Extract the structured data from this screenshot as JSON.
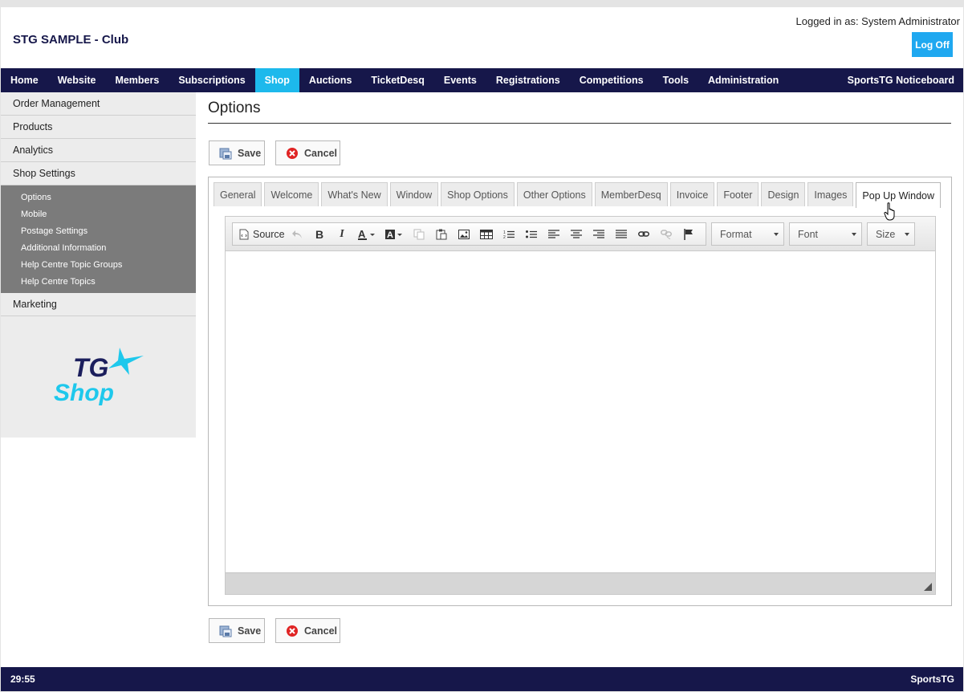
{
  "header": {
    "site_title": "STG SAMPLE - Club",
    "logged_in_text": "Logged in as: System Administrator",
    "logoff_label": "Log Off"
  },
  "nav": {
    "items": [
      "Home",
      "Website",
      "Members",
      "Subscriptions",
      "Shop",
      "Auctions",
      "TicketDesq",
      "Events",
      "Registrations",
      "Competitions",
      "Tools",
      "Administration"
    ],
    "active": "Shop",
    "right_label": "SportsTG Noticeboard"
  },
  "sidebar": {
    "items": [
      "Order Management",
      "Products",
      "Analytics",
      "Shop Settings"
    ],
    "sub_items": [
      "Options",
      "Mobile",
      "Postage Settings",
      "Additional Information",
      "Help Centre Topic Groups",
      "Help Centre Topics"
    ],
    "after_items": [
      "Marketing"
    ],
    "logo_text_top": "TG",
    "logo_text_bottom": "Shop"
  },
  "main": {
    "title": "Options",
    "save_label": "Save",
    "cancel_label": "Cancel",
    "tabs": [
      "General",
      "Welcome",
      "What's New",
      "Window",
      "Shop Options",
      "Other Options",
      "MemberDesq",
      "Invoice",
      "Footer",
      "Design",
      "Images",
      "Pop Up Window"
    ],
    "active_tab": "Pop Up Window"
  },
  "editor": {
    "source_label": "Source",
    "format_label": "Format",
    "font_label": "Font",
    "size_label": "Size",
    "toolbar_icons": [
      "undo-icon",
      "bold-icon",
      "italic-icon",
      "text-color-icon",
      "background-color-icon",
      "copy-icon",
      "paste-icon",
      "image-icon",
      "table-icon",
      "numbered-list-icon",
      "bulleted-list-icon",
      "align-left-icon",
      "align-center-icon",
      "align-right-icon",
      "justify-icon",
      "link-icon",
      "unlink-icon",
      "anchor-flag-icon"
    ]
  },
  "footer": {
    "time": "29:55",
    "brand": "SportsTG"
  },
  "colors": {
    "nav_bg": "#16174a",
    "nav_active": "#1db9ec",
    "logoff_bg": "#1fa8f0",
    "sidebar_sub_bg": "#7b7b7b",
    "logo_cyan": "#1ec8ec",
    "logo_navy": "#1b1e5c"
  }
}
